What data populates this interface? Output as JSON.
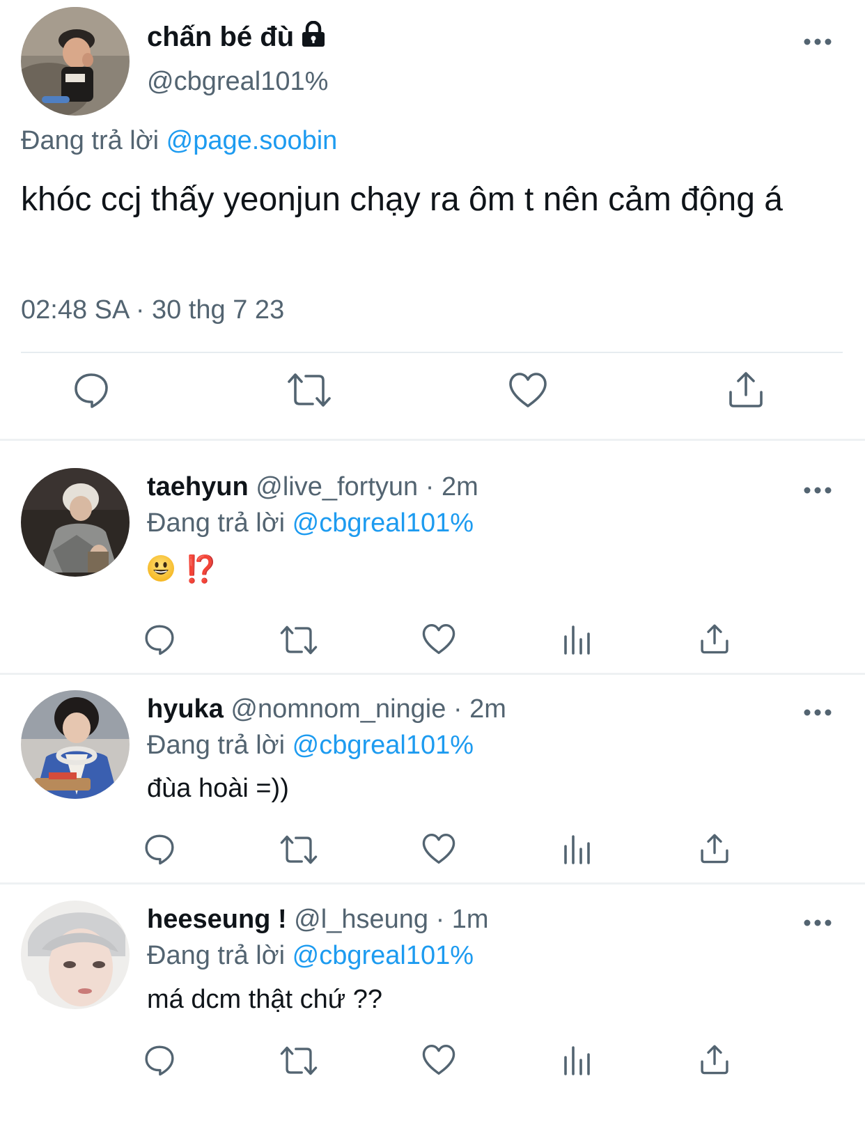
{
  "main_tweet": {
    "display_name": "chấn bé đù",
    "handle": "@cbgreal101%",
    "replying_prefix": "Đang trả lời",
    "replying_to": "@page.soobin",
    "text": "khóc ccj thấy yeonjun chạy ra ôm t nên cảm động á",
    "time": "02:48 SA",
    "date_separator": "·",
    "date": "30 thg 7 23",
    "icons": [
      "lock-icon",
      "more-icon",
      "reply-icon",
      "retweet-icon",
      "like-icon",
      "share-icon"
    ]
  },
  "replies": [
    {
      "display_name": "taehyun",
      "handle": "@live_fortyun",
      "separator": "·",
      "time": "2m",
      "replying_prefix": "Đang trả lời",
      "replying_to": "@cbgreal101%",
      "text_emoji": "😃",
      "text": "⁉️"
    },
    {
      "display_name": "hyuka",
      "handle": "@nomnom_ningie",
      "separator": "·",
      "time": "2m",
      "replying_prefix": "Đang trả lời",
      "replying_to": "@cbgreal101%",
      "text": "đùa hoài =))"
    },
    {
      "display_name": "heeseung !",
      "handle": "@l_hseung",
      "separator": "·",
      "time": "1m",
      "replying_prefix": "Đang trả lời",
      "replying_to": "@cbgreal101%",
      "text": "má dcm thật chứ ??"
    }
  ],
  "reply_actions": [
    "reply-icon",
    "retweet-icon",
    "like-icon",
    "views-icon",
    "share-icon"
  ],
  "colors": {
    "link": "#1d9bf0",
    "secondary_text": "#536471",
    "primary_text": "#0f1419",
    "icon": "#536471",
    "divider": "#e6ecf0"
  }
}
